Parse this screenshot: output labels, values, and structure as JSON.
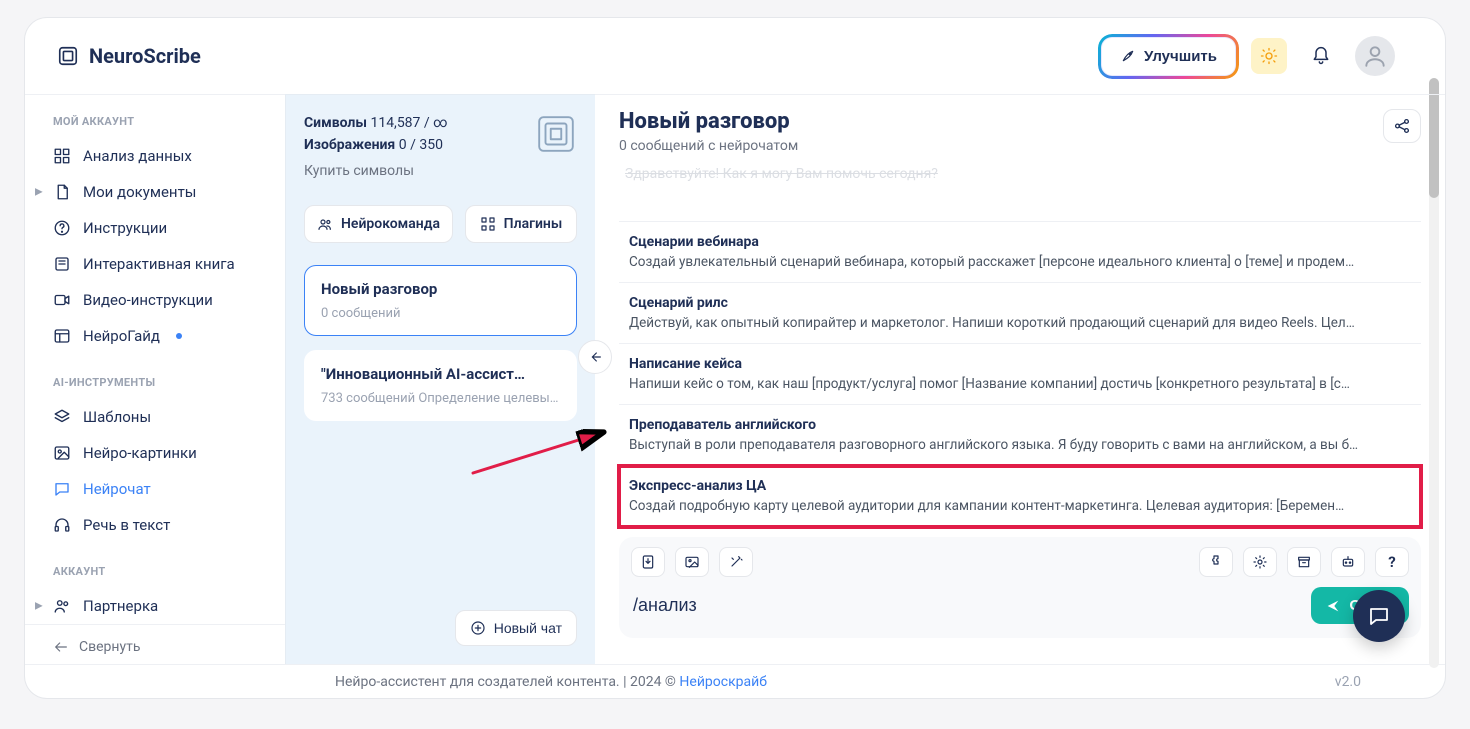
{
  "brand": "NeuroScribe",
  "header": {
    "upgrade": "Улучшить"
  },
  "sidebar": {
    "section1": "МОЙ АККАУНТ",
    "items1": [
      {
        "label": "Анализ данных"
      },
      {
        "label": "Мои документы"
      },
      {
        "label": "Инструкции"
      },
      {
        "label": "Интерактивная книга"
      },
      {
        "label": "Видео-инструкции"
      },
      {
        "label": "НейроГайд"
      }
    ],
    "section2": "AI-ИНСТРУМЕНТЫ",
    "items2": [
      {
        "label": "Шаблоны"
      },
      {
        "label": "Нейро-картинки"
      },
      {
        "label": "Нейрочат"
      },
      {
        "label": "Речь в текст"
      }
    ],
    "section3": "АККАУНТ",
    "items3": [
      {
        "label": "Партнерка"
      }
    ],
    "collapse": "Свернуть"
  },
  "mid": {
    "sym_label": "Символы",
    "sym_val": "114,587 / ∞",
    "img_label": "Изображения",
    "img_val": "0 / 350",
    "buy": "Купить символы",
    "tab1": "Нейрокоманда",
    "tab2": "Плагины",
    "convs": [
      {
        "title": "Новый разговор",
        "meta": "0 сообщений"
      },
      {
        "title": "\"Инновационный AI-ассист…",
        "meta": "733 сообщений Определение целевы…"
      }
    ],
    "new_chat": "Новый чат"
  },
  "chat": {
    "title": "Новый разговор",
    "subtitle": "0 сообщений с нейрочатом",
    "greeting": "Здравствуйте! Как я могу Вам помочь сегодня?",
    "templates": [
      {
        "t": "Сценарии вебинара",
        "d": "Создай увлекательный сценарий вебинара, который расскажет [персоне идеального клиента] о [теме] и продем…"
      },
      {
        "t": "Сценарий рилс",
        "d": "Действуй, как опытный копирайтер и маркетолог. Напиши короткий продающий сценарий для видео Reels. Цел…"
      },
      {
        "t": "Написание кейса",
        "d": "Напиши кейс о том, как наш [продукт/услуга] помог [Название компании] достичь [конкретного результата] в [с…"
      },
      {
        "t": "Преподаватель английского",
        "d": "Выступай в роли преподавателя разговорного английского языка. Я буду говорить с вами на английском, а вы б…"
      },
      {
        "t": "Экспресс-анализ ЦА",
        "d": "Создай подробную карту целевой аудитории для кампании контент-маркетинга. Целевая аудитория: [Беремен…"
      }
    ],
    "input_value": "/анализ",
    "send": "Отпра",
    "question_mark": "?"
  },
  "footer": {
    "text_a": "Нейро-ассистент для создателей контента.  | 2024 © ",
    "link": "Нейроскрайб",
    "version": "v2.0"
  }
}
